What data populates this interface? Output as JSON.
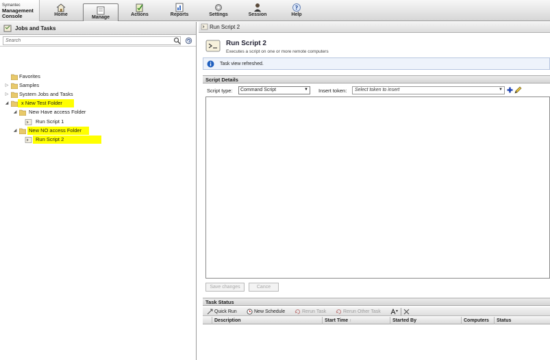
{
  "app": {
    "logo_brand": "Symantec",
    "logo_line1": "Management",
    "logo_line2": "Console"
  },
  "nav": {
    "tabs": [
      {
        "label": "Home",
        "icon": "home-icon"
      },
      {
        "label": "Manage",
        "icon": "manage-icon",
        "active": true
      },
      {
        "label": "Actions",
        "icon": "actions-icon"
      },
      {
        "label": "Reports",
        "icon": "reports-icon"
      },
      {
        "label": "Settings",
        "icon": "settings-icon"
      },
      {
        "label": "Session",
        "icon": "session-icon"
      },
      {
        "label": "Help",
        "icon": "help-icon"
      }
    ]
  },
  "left_pane": {
    "title": "Jobs and Tasks",
    "search_placeholder": "Search",
    "tree": [
      {
        "label": "Favorites",
        "icon": "folder-icon"
      },
      {
        "label": "Samples",
        "icon": "folder-icon"
      },
      {
        "label": "System Jobs and Tasks",
        "icon": "folder-icon"
      },
      {
        "label": "x New Test Folder",
        "icon": "folder-icon"
      },
      {
        "label": "New Have access Folder",
        "icon": "folder-icon"
      },
      {
        "label": "Run Script 1",
        "icon": "script-task-icon"
      },
      {
        "label": "New NO access Folder",
        "icon": "folder-icon"
      },
      {
        "label": "Run Script 2",
        "icon": "script-task-icon"
      }
    ]
  },
  "right_pane": {
    "header_title": "Run Script 2",
    "task_title": "Run Script 2",
    "task_subtitle": "Executes a script on one or more remote computers",
    "info_message": "Task view refreshed.",
    "script_details": {
      "section_title": "Script Details",
      "script_type_label": "Script type:",
      "script_type_value": "Command Script",
      "insert_token_label": "Insert token:",
      "insert_token_placeholder": "Select token to insert",
      "script_content": "",
      "save_label": "Save changes",
      "cancel_label": "Cance"
    },
    "task_status": {
      "section_title": "Task Status",
      "toolbar": {
        "quick_run": "Quick Run",
        "new_schedule": "New Schedule",
        "rerun_task": "Rerun Task",
        "rerun_other_task": "Rerun Other Task"
      },
      "columns": [
        "Description",
        "Start Time",
        "Started By",
        "Computers",
        "Status"
      ],
      "sorted_column_indicator": "↑",
      "rows": []
    }
  },
  "colors": {
    "highlight": "#ffff00",
    "info_icon": "#1f5fbf",
    "add_icon": "#1a3fb0"
  }
}
